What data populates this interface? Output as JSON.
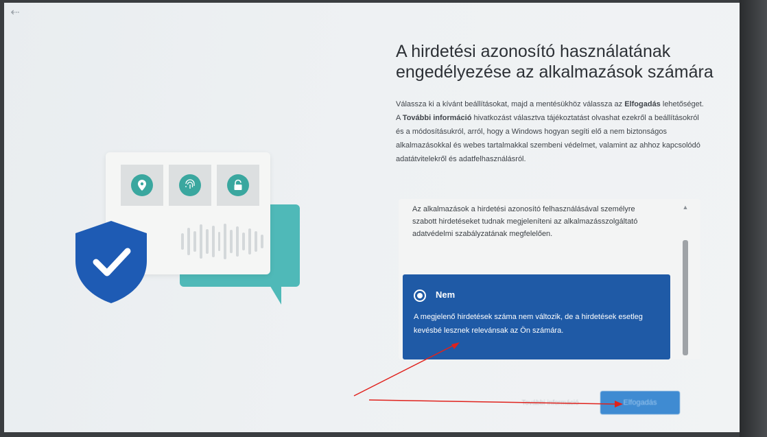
{
  "nav": {
    "back_icon": "back-arrow-icon",
    "back_glyph": "⇠"
  },
  "title": "A hirdetési azonosító használatának engedélyezése az alkalmazások számára",
  "description": {
    "part1": "Válassza ki a kívánt beállításokat, majd a mentésükhöz válassza az ",
    "bold1": "Elfogadás",
    "part2": " lehetőséget. A ",
    "bold2": "További információ",
    "part3": " hivatkozást választva tájékoztatást olvashat ezekről a beállításokról és a módosításukról, arról, hogy a Windows hogyan segíti elő a nem biztonságos alkalmazásokkal és webes tartalmakkal szembeni védelmet, valamint az ahhoz kapcsolódó adatátvitelekről és adatfelhasználásról."
  },
  "info_text": "Az alkalmazások a hirdetési azonosító felhasználásával személyre szabott hirdetéseket tudnak megjeleníteni az alkalmazásszolgáltató adatvédelmi szabályzatának megfelelően.",
  "option": {
    "label": "Nem",
    "selected": true,
    "description": "A megjelenő hirdetések száma nem változik, de a hirdetések esetleg kevésbé lesznek relevánsak az Ön számára."
  },
  "buttons": {
    "more_info": "További információ",
    "accept": "Elfogadás"
  },
  "colors": {
    "selected_option": "#1f5aa6",
    "accept_button": "#3f8bd2",
    "teal": "#4fb9b8",
    "shield": "#1e5bb4",
    "annotation_arrow": "#e0221c"
  },
  "illustration_icons": [
    "location-icon",
    "fingerprint-icon",
    "lock-icon",
    "shield-check-icon"
  ]
}
